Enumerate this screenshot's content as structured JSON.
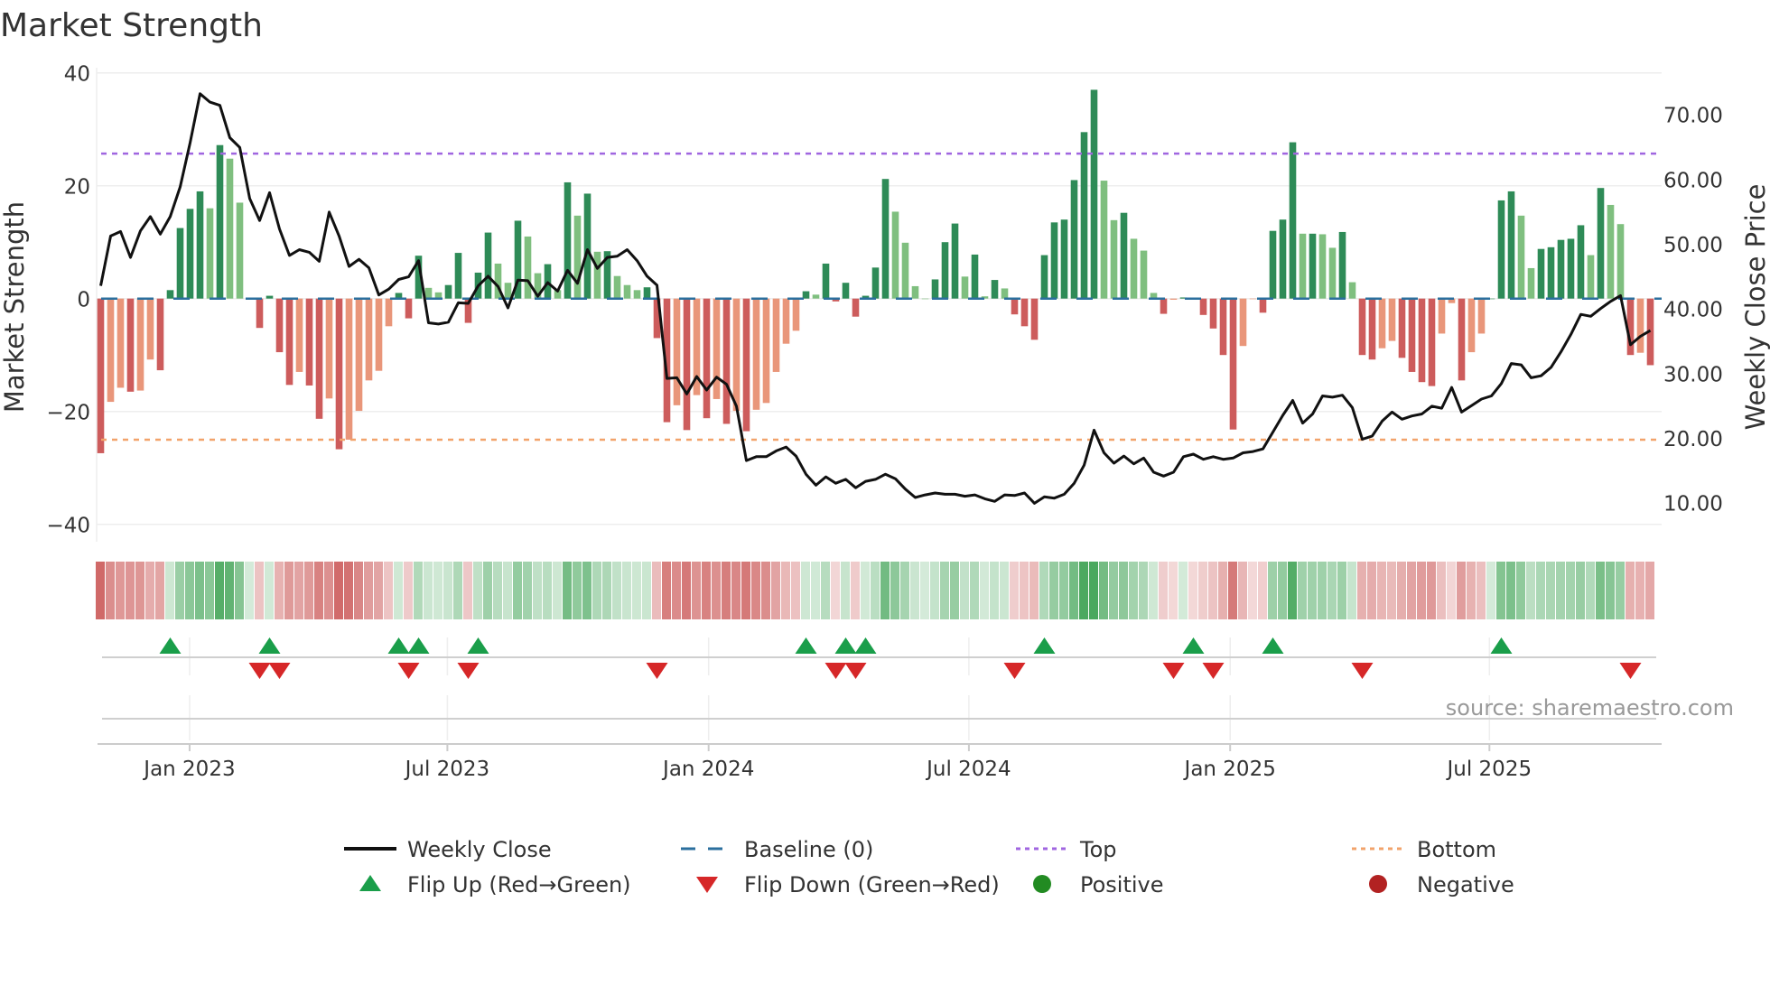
{
  "title": "Market Strength",
  "source": "source: sharemaestro.com",
  "chart_data": {
    "type": "bar",
    "title": "Market Strength",
    "ylabel": "Market Strength",
    "ylabel_right": "Weekly Close Price",
    "ylim": [
      -40,
      40
    ],
    "ylim_right": [
      3.3,
      77.2
    ],
    "yticks": [
      {
        "v": 40,
        "label": "40"
      },
      {
        "v": 20,
        "label": "20"
      },
      {
        "v": 0,
        "label": "0"
      },
      {
        "v": -20,
        "label": "−20"
      },
      {
        "v": -40,
        "label": "−40"
      }
    ],
    "yticks_right": [
      {
        "v": 70,
        "label": "70.00"
      },
      {
        "v": 60,
        "label": "60.00"
      },
      {
        "v": 50,
        "label": "50.00"
      },
      {
        "v": 40,
        "label": "40.00"
      },
      {
        "v": 30,
        "label": "30.00"
      },
      {
        "v": 20,
        "label": "20.00"
      },
      {
        "v": 10,
        "label": "10.00"
      }
    ],
    "xticks": [
      {
        "week": 8.95,
        "label": "Jan 2023"
      },
      {
        "week": 34.9,
        "label": "Jul 2023"
      },
      {
        "week": 61.2,
        "label": "Jan 2024"
      },
      {
        "week": 87.4,
        "label": "Jul 2024"
      },
      {
        "week": 113.7,
        "label": "Jan 2025"
      },
      {
        "week": 139.8,
        "label": "Jul 2025"
      }
    ],
    "top": 25.7,
    "bottom": -25,
    "baseline": 0,
    "strength": [
      -27.4,
      -18.3,
      -15.8,
      -16.5,
      -16.3,
      -10.8,
      -12.7,
      1.5,
      12.5,
      15.9,
      19,
      16,
      27.2,
      24.8,
      17,
      0,
      -5.2,
      0.5,
      -9.5,
      -15.3,
      -13,
      -15.4,
      -21.3,
      -17.7,
      -26.7,
      -25,
      -19.9,
      -14.5,
      -12.8,
      -4.9,
      1,
      -3.5,
      7.6,
      1.9,
      1.1,
      2.4,
      8.1,
      -4.3,
      4.6,
      11.7,
      6.2,
      2.8,
      13.8,
      11,
      4.5,
      6.1,
      1.5,
      20.6,
      14.7,
      18.6,
      8.3,
      8.4,
      4,
      2.4,
      1.5,
      2,
      -7,
      -21.9,
      -18.9,
      -23.3,
      -17.1,
      -21.2,
      -17.8,
      -22.2,
      -19.9,
      -23.5,
      -19.7,
      -18.5,
      -13,
      -8,
      -5.7,
      1.3,
      0.7,
      6.2,
      -0.5,
      2.8,
      -3.2,
      0.5,
      5.5,
      21.2,
      15.4,
      9.9,
      2.2,
      0,
      3.4,
      10,
      13.3,
      3.9,
      7.8,
      0.4,
      3.3,
      1.8,
      -2.8,
      -4.9,
      -7.3,
      7.7,
      13.5,
      14,
      21,
      29.5,
      37,
      20.9,
      13.9,
      15.2,
      10.6,
      8.5,
      1,
      -2.7,
      -0.2,
      0.2,
      -0.2,
      -2.9,
      -5.3,
      -10,
      -23.2,
      -8.4,
      -0.1,
      -2.5,
      12,
      14,
      27.7,
      11.5,
      11.5,
      11.4,
      9,
      11.8,
      2.9,
      -10,
      -10.8,
      -8.8,
      -7.5,
      -10.5,
      -13,
      -14.8,
      -15.5,
      -6.2,
      -0.8,
      -14.5,
      -9.5,
      -6.2,
      0,
      17.4,
      19,
      14.7,
      5.4,
      8.8,
      9.1,
      10.4,
      10.6,
      13,
      7.7,
      19.6,
      16.6,
      13.2,
      -10,
      -9.6,
      -11.8
    ],
    "close": [
      43.5,
      51.2,
      51.9,
      47.9,
      52,
      54.2,
      51.5,
      54.2,
      58.8,
      65.6,
      73.2,
      71.9,
      71.4,
      66.4,
      64.9,
      57,
      53.6,
      57.9,
      52.3,
      48.2,
      49.1,
      48.7,
      47.3,
      54.9,
      51.2,
      46.5,
      47.6,
      46.3,
      42.1,
      43,
      44.5,
      44.9,
      47.4,
      37.8,
      37.6,
      37.9,
      40.9,
      40.8,
      43.5,
      45,
      43.4,
      40.1,
      44.4,
      44.3,
      41.9,
      44,
      42.7,
      45.9,
      43.9,
      49.1,
      46.2,
      47.9,
      48.1,
      49.1,
      47.4,
      45,
      43.6,
      29.2,
      29.3,
      26.8,
      29.5,
      27.4,
      29.4,
      28.3,
      24.9,
      16.5,
      17.1,
      17.1,
      18,
      18.6,
      17.2,
      14.4,
      12.7,
      14,
      13,
      13.6,
      12.3,
      13.3,
      13.6,
      14.4,
      13.7,
      12.1,
      10.8,
      11.2,
      11.5,
      11.3,
      11.3,
      11,
      11.2,
      10.6,
      10.2,
      11.2,
      11.1,
      11.5,
      9.9,
      10.9,
      10.7,
      11.3,
      13,
      15.8,
      21.2,
      17.7,
      16.1,
      17.2,
      16,
      16.9,
      14.7,
      14.1,
      14.7,
      17.1,
      17.5,
      16.7,
      17.1,
      16.7,
      16.9,
      17.7,
      17.9,
      18.3,
      20.9,
      23.5,
      25.8,
      22.3,
      23.7,
      26.5,
      26.3,
      26.6,
      24.7,
      19.8,
      20.3,
      22.6,
      24,
      22.9,
      23.4,
      23.7,
      24.9,
      24.6,
      27.8,
      24,
      25,
      26,
      26.5,
      28.4,
      31.5,
      31.3,
      29.3,
      29.6,
      30.9,
      33.3,
      36,
      39.1,
      38.8,
      40,
      41.1,
      42,
      34.4,
      35.7,
      36.6
    ],
    "flip_up_weeks": [
      7,
      17,
      30,
      32,
      38,
      71,
      75,
      77,
      95,
      110,
      118,
      141
    ],
    "flip_down_weeks": [
      16,
      18,
      31,
      37,
      56,
      74,
      76,
      92,
      108,
      112,
      127,
      154
    ],
    "legend": [
      {
        "label": "Weekly Close",
        "kind": "line",
        "color": "#111111"
      },
      {
        "label": "Baseline (0)",
        "kind": "dash",
        "color": "#2b6f9e"
      },
      {
        "label": "Top",
        "kind": "dot",
        "color": "#a066e0"
      },
      {
        "label": "Bottom",
        "kind": "dot",
        "color": "#f2a36b"
      },
      {
        "label": "Flip Up (Red→Green)",
        "kind": "up",
        "color": "#1a9e4a"
      },
      {
        "label": "Flip Down (Green→Red)",
        "kind": "down",
        "color": "#d62728"
      },
      {
        "label": "Positive",
        "kind": "circle",
        "color": "#228b22"
      },
      {
        "label": "Negative",
        "kind": "circle",
        "color": "#b22222"
      }
    ],
    "legend_placement": "bottom"
  },
  "colors": {
    "pos_strong": "#2e8b57",
    "pos_weak": "#7fbf7f",
    "neg_strong": "#cd5c5c",
    "neg_weak": "#e9967a",
    "close": "#111111",
    "baseline": "#2b6f9e",
    "top": "#a066e0",
    "bottom": "#f2a36b",
    "heat_pos": "#3aa050",
    "heat_neg": "#c8504f"
  }
}
